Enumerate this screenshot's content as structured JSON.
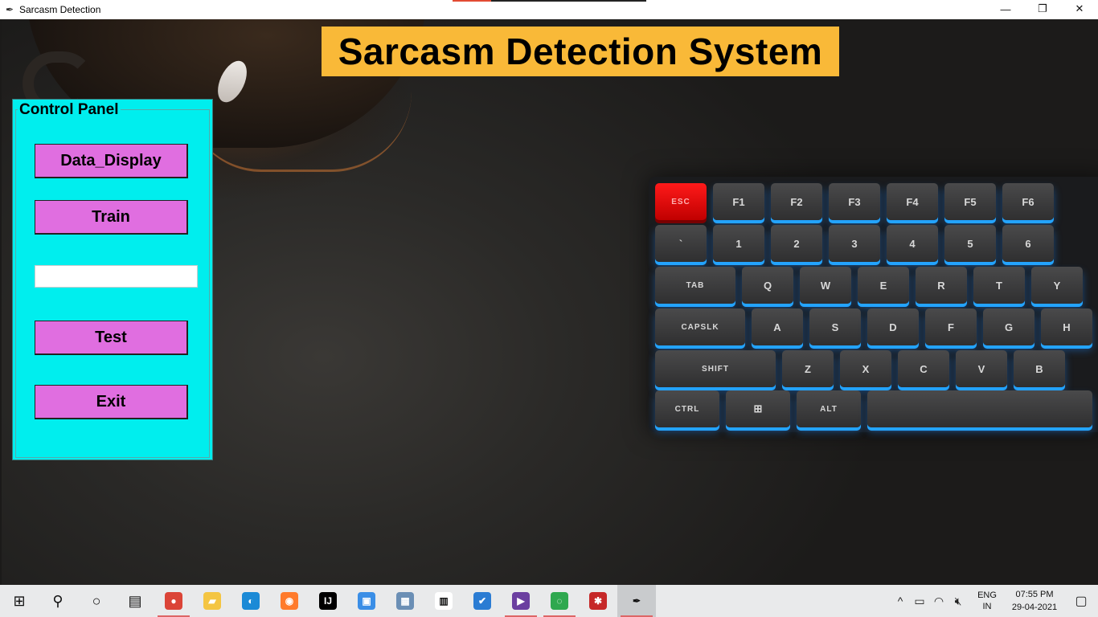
{
  "window": {
    "title": "Sarcasm Detection",
    "icon": "feather-icon",
    "minimize": "—",
    "restore": "❐",
    "close": "✕"
  },
  "banner": {
    "title": "Sarcasm Detection System",
    "color": "#f9b938"
  },
  "control_panel": {
    "legend": "Control Panel",
    "background": "#00eeee",
    "button_color": "#e06ee0",
    "data_display_label": "Data_Display",
    "train_label": "Train",
    "text_input_value": "",
    "test_label": "Test",
    "exit_label": "Exit"
  },
  "keyboard": {
    "row1": [
      "ESC",
      "F1",
      "F2",
      "F3",
      "F4",
      "F5",
      "F6"
    ],
    "row2": [
      "`",
      "1",
      "2",
      "3",
      "4",
      "5",
      "6"
    ],
    "row3": [
      "TAB",
      "Q",
      "W",
      "E",
      "R",
      "T",
      "Y"
    ],
    "row4": [
      "CAPSLK",
      "A",
      "S",
      "D",
      "F",
      "G",
      "H"
    ],
    "row5": [
      "SHIFT",
      "Z",
      "X",
      "C",
      "V",
      "B"
    ],
    "row6": [
      "CTRL",
      "⊞",
      "ALT",
      ""
    ]
  },
  "taskbar": {
    "items": [
      {
        "name": "start-icon",
        "glyph": "⊞"
      },
      {
        "name": "search-icon",
        "glyph": "⚲"
      },
      {
        "name": "cortana-icon",
        "glyph": "○"
      },
      {
        "name": "task-view-icon",
        "glyph": "▤"
      },
      {
        "name": "chrome-icon",
        "glyph": "●"
      },
      {
        "name": "file-explorer-icon",
        "glyph": "▰"
      },
      {
        "name": "edge-icon",
        "glyph": "◐"
      },
      {
        "name": "firefox-icon",
        "glyph": "◉"
      },
      {
        "name": "intellij-icon",
        "glyph": "IJ"
      },
      {
        "name": "control-panel-icon",
        "glyph": "▣"
      },
      {
        "name": "network-icon",
        "glyph": "▦"
      },
      {
        "name": "store-icon",
        "glyph": "▥"
      },
      {
        "name": "todo-icon",
        "glyph": "✔"
      },
      {
        "name": "visual-studio-icon",
        "glyph": "▶"
      },
      {
        "name": "circle-app-icon",
        "glyph": "◌"
      },
      {
        "name": "spider-icon",
        "glyph": "✱"
      },
      {
        "name": "python-feather-icon",
        "glyph": "✒"
      }
    ],
    "lang_line1": "ENG",
    "lang_line2": "IN",
    "time": "07:55 PM",
    "date": "29-04-2021"
  }
}
